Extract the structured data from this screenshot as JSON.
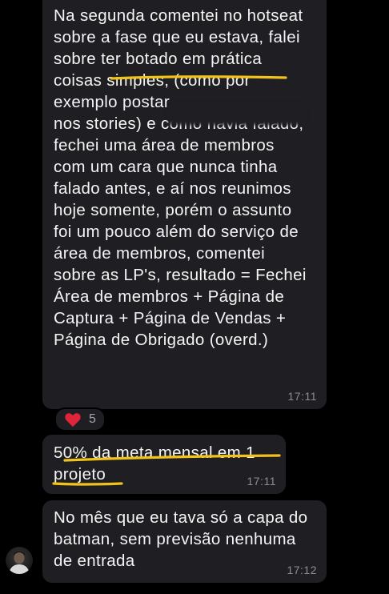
{
  "messages": [
    {
      "text": "Na segunda comentei no hotseat\nsobre a fase que eu estava, falei\nsobre ter botado em prática\ncoisas simples, (como por\nexemplo postar\nnos stories) e como havia falado,\nfechei uma área de membros\ncom um cara que nunca tinha\nfalado antes, e aí nos reunimos\nhoje somente, porém o assunto\nfoi um pouco além do serviço de\nárea de membros, comentei\nsobre as LP's, resultado = Fechei\nÁrea de membros + Página de\nCaptura + Página de Vendas +\nPágina de Obrigado (overd.)",
      "time": "17:11"
    },
    {
      "text": "50% da meta mensal em 1\nprojeto",
      "time": "17:11"
    },
    {
      "text": "No mês que eu tava só a capa do\nbatman, sem previsão nenhuma\nde entrada",
      "time": "17:12"
    }
  ],
  "reaction": {
    "icon": "heart-icon",
    "color": "#e0243a",
    "count": "5"
  },
  "colors": {
    "background": "#000000",
    "bubble": "#1f1f23",
    "highlight_marker": "#f0c21a"
  }
}
